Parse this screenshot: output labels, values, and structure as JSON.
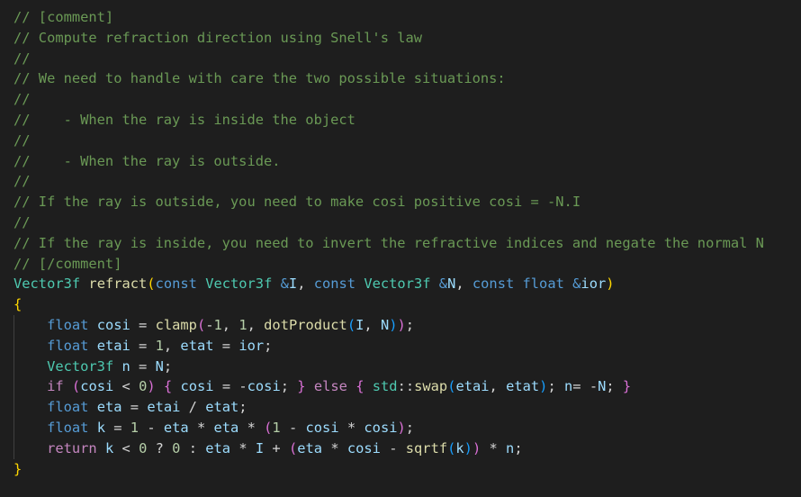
{
  "colors": {
    "background": "#1e1e1e",
    "comment": "#6a9955",
    "keyword": "#569cd6",
    "control": "#c586c0",
    "type": "#4ec9b0",
    "function": "#dcdcaa",
    "parameter": "#9cdcfe",
    "number": "#b5cea8",
    "text": "#d4d4d4",
    "bracket_level1": "#ffd700",
    "bracket_level2": "#da70d6",
    "bracket_level3": "#179fff"
  },
  "code": {
    "lines": [
      [
        [
          "c",
          "// [comment]"
        ]
      ],
      [
        [
          "c",
          "// Compute refraction direction using Snell's law"
        ]
      ],
      [
        [
          "c",
          "//"
        ]
      ],
      [
        [
          "c",
          "// We need to handle with care the two possible situations:"
        ]
      ],
      [
        [
          "c",
          "//"
        ]
      ],
      [
        [
          "c",
          "//    - When the ray is inside the object"
        ]
      ],
      [
        [
          "c",
          "//"
        ]
      ],
      [
        [
          "c",
          "//    - When the ray is outside."
        ]
      ],
      [
        [
          "c",
          "//"
        ]
      ],
      [
        [
          "c",
          "// If the ray is outside, you need to make cosi positive cosi = -N.I"
        ]
      ],
      [
        [
          "c",
          "//"
        ]
      ],
      [
        [
          "c",
          "// If the ray is inside, you need to invert the refractive indices and negate the normal N"
        ]
      ],
      [
        [
          "c",
          "// [/comment]"
        ]
      ],
      [
        [
          "t",
          "Vector3f"
        ],
        [
          "p",
          " "
        ],
        [
          "f",
          "refract"
        ],
        [
          "b1",
          "("
        ],
        [
          "k",
          "const"
        ],
        [
          "p",
          " "
        ],
        [
          "t",
          "Vector3f"
        ],
        [
          "p",
          " "
        ],
        [
          "k",
          "&"
        ],
        [
          "v",
          "I"
        ],
        [
          "p",
          ", "
        ],
        [
          "k",
          "const"
        ],
        [
          "p",
          " "
        ],
        [
          "t",
          "Vector3f"
        ],
        [
          "p",
          " "
        ],
        [
          "k",
          "&"
        ],
        [
          "v",
          "N"
        ],
        [
          "p",
          ", "
        ],
        [
          "k",
          "const"
        ],
        [
          "p",
          " "
        ],
        [
          "k",
          "float"
        ],
        [
          "p",
          " "
        ],
        [
          "k",
          "&"
        ],
        [
          "v",
          "ior"
        ],
        [
          "b1",
          ")"
        ]
      ],
      [
        [
          "b1",
          "{"
        ]
      ],
      [
        [
          "p",
          "    "
        ],
        [
          "k",
          "float"
        ],
        [
          "p",
          " "
        ],
        [
          "v",
          "cosi"
        ],
        [
          "p",
          " = "
        ],
        [
          "f",
          "clamp"
        ],
        [
          "b2",
          "("
        ],
        [
          "p",
          "-"
        ],
        [
          "n",
          "1"
        ],
        [
          "p",
          ", "
        ],
        [
          "n",
          "1"
        ],
        [
          "p",
          ", "
        ],
        [
          "f",
          "dotProduct"
        ],
        [
          "b3",
          "("
        ],
        [
          "v",
          "I"
        ],
        [
          "p",
          ", "
        ],
        [
          "v",
          "N"
        ],
        [
          "b3",
          ")"
        ],
        [
          "b2",
          ")"
        ],
        [
          "p",
          ";"
        ]
      ],
      [
        [
          "p",
          "    "
        ],
        [
          "k",
          "float"
        ],
        [
          "p",
          " "
        ],
        [
          "v",
          "etai"
        ],
        [
          "p",
          " = "
        ],
        [
          "n",
          "1"
        ],
        [
          "p",
          ", "
        ],
        [
          "v",
          "etat"
        ],
        [
          "p",
          " = "
        ],
        [
          "v",
          "ior"
        ],
        [
          "p",
          ";"
        ]
      ],
      [
        [
          "p",
          "    "
        ],
        [
          "t",
          "Vector3f"
        ],
        [
          "p",
          " "
        ],
        [
          "v",
          "n"
        ],
        [
          "p",
          " = "
        ],
        [
          "v",
          "N"
        ],
        [
          "p",
          ";"
        ]
      ],
      [
        [
          "p",
          "    "
        ],
        [
          "x",
          "if"
        ],
        [
          "p",
          " "
        ],
        [
          "b2",
          "("
        ],
        [
          "v",
          "cosi"
        ],
        [
          "p",
          " < "
        ],
        [
          "n",
          "0"
        ],
        [
          "b2",
          ")"
        ],
        [
          "p",
          " "
        ],
        [
          "b2",
          "{"
        ],
        [
          "p",
          " "
        ],
        [
          "v",
          "cosi"
        ],
        [
          "p",
          " = -"
        ],
        [
          "v",
          "cosi"
        ],
        [
          "p",
          "; "
        ],
        [
          "b2",
          "}"
        ],
        [
          "p",
          " "
        ],
        [
          "x",
          "else"
        ],
        [
          "p",
          " "
        ],
        [
          "b2",
          "{"
        ],
        [
          "p",
          " "
        ],
        [
          "t",
          "std"
        ],
        [
          "p",
          "::"
        ],
        [
          "f",
          "swap"
        ],
        [
          "b3",
          "("
        ],
        [
          "v",
          "etai"
        ],
        [
          "p",
          ", "
        ],
        [
          "v",
          "etat"
        ],
        [
          "b3",
          ")"
        ],
        [
          "p",
          "; "
        ],
        [
          "v",
          "n"
        ],
        [
          "p",
          "= -"
        ],
        [
          "v",
          "N"
        ],
        [
          "p",
          "; "
        ],
        [
          "b2",
          "}"
        ]
      ],
      [
        [
          "p",
          "    "
        ],
        [
          "k",
          "float"
        ],
        [
          "p",
          " "
        ],
        [
          "v",
          "eta"
        ],
        [
          "p",
          " = "
        ],
        [
          "v",
          "etai"
        ],
        [
          "p",
          " / "
        ],
        [
          "v",
          "etat"
        ],
        [
          "p",
          ";"
        ]
      ],
      [
        [
          "p",
          "    "
        ],
        [
          "k",
          "float"
        ],
        [
          "p",
          " "
        ],
        [
          "v",
          "k"
        ],
        [
          "p",
          " = "
        ],
        [
          "n",
          "1"
        ],
        [
          "p",
          " - "
        ],
        [
          "v",
          "eta"
        ],
        [
          "p",
          " * "
        ],
        [
          "v",
          "eta"
        ],
        [
          "p",
          " * "
        ],
        [
          "b2",
          "("
        ],
        [
          "n",
          "1"
        ],
        [
          "p",
          " - "
        ],
        [
          "v",
          "cosi"
        ],
        [
          "p",
          " * "
        ],
        [
          "v",
          "cosi"
        ],
        [
          "b2",
          ")"
        ],
        [
          "p",
          ";"
        ]
      ],
      [
        [
          "p",
          "    "
        ],
        [
          "x",
          "return"
        ],
        [
          "p",
          " "
        ],
        [
          "v",
          "k"
        ],
        [
          "p",
          " < "
        ],
        [
          "n",
          "0"
        ],
        [
          "p",
          " ? "
        ],
        [
          "n",
          "0"
        ],
        [
          "p",
          " : "
        ],
        [
          "v",
          "eta"
        ],
        [
          "p",
          " * "
        ],
        [
          "v",
          "I"
        ],
        [
          "p",
          " + "
        ],
        [
          "b2",
          "("
        ],
        [
          "v",
          "eta"
        ],
        [
          "p",
          " * "
        ],
        [
          "v",
          "cosi"
        ],
        [
          "p",
          " - "
        ],
        [
          "f",
          "sqrtf"
        ],
        [
          "b3",
          "("
        ],
        [
          "v",
          "k"
        ],
        [
          "b3",
          ")"
        ],
        [
          "b2",
          ")"
        ],
        [
          "p",
          " * "
        ],
        [
          "v",
          "n"
        ],
        [
          "p",
          ";"
        ]
      ],
      [
        [
          "b1",
          "}"
        ]
      ]
    ]
  }
}
